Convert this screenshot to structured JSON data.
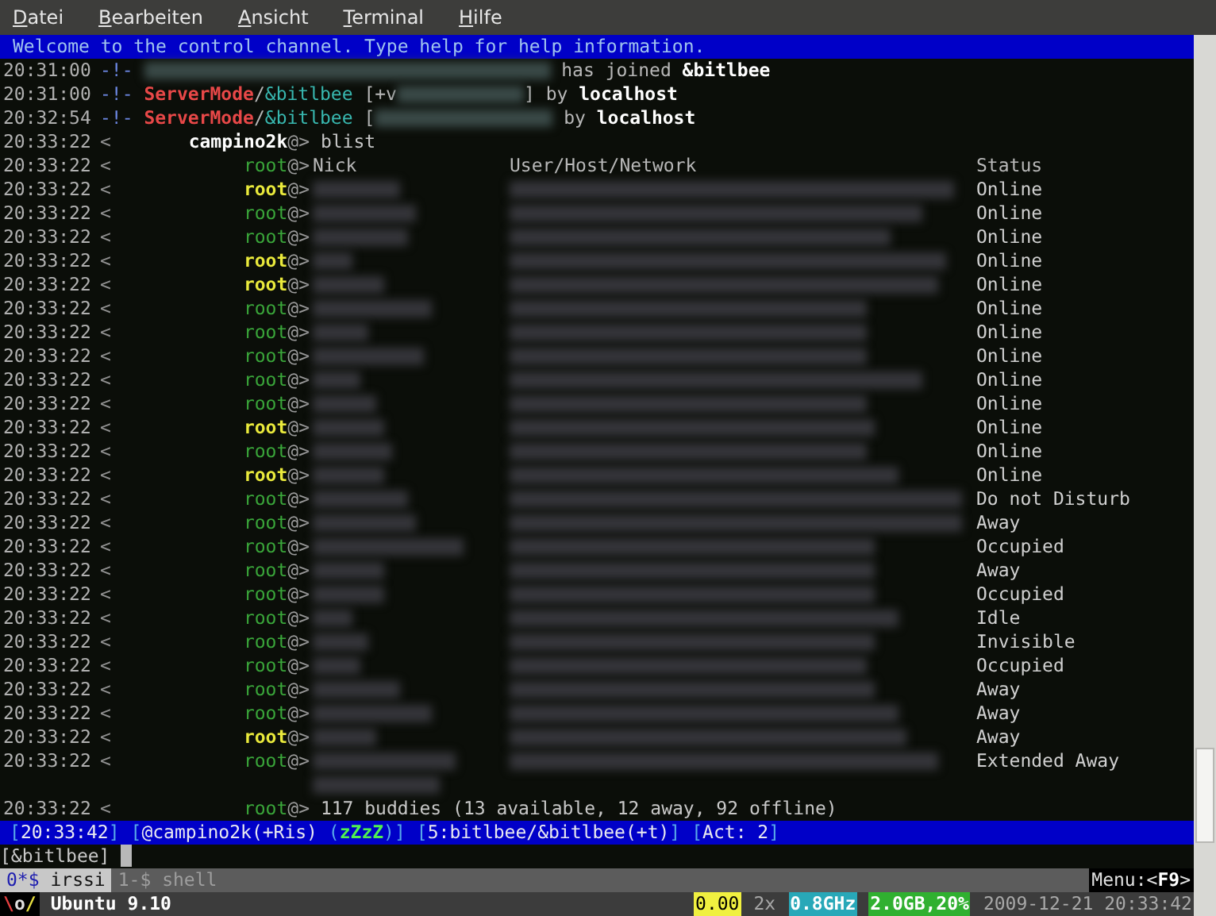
{
  "menu": [
    "Datei",
    "Bearbeiten",
    "Ansicht",
    "Terminal",
    "Hilfe"
  ],
  "topic": "Welcome to the control channel. Type help for help information.",
  "lines": [
    {
      "kind": "event",
      "time": "20:31:00",
      "segments": [
        {
          "kind": "text",
          "runs": [
            {
              "text": "-!- ",
              "kind": "marker"
            }
          ]
        },
        {
          "kind": "redacted"
        },
        {
          "kind": "text",
          "runs": [
            {
              "text": " has joined ",
              "kind": "plain"
            },
            {
              "text": "&bitlbee",
              "kind": "bold"
            }
          ]
        }
      ]
    },
    {
      "kind": "event",
      "time": "20:31:00",
      "segments": [
        {
          "kind": "text",
          "runs": [
            {
              "text": "-!- ",
              "kind": "marker"
            },
            {
              "text": "ServerMode",
              "kind": "mode"
            },
            {
              "text": "/",
              "kind": "plain"
            },
            {
              "text": "&bitlbee",
              "kind": "channel"
            },
            {
              "text": " [+v",
              "kind": "plain"
            }
          ]
        },
        {
          "kind": "redacted"
        },
        {
          "kind": "text",
          "runs": [
            {
              "text": "] by ",
              "kind": "plain"
            },
            {
              "text": "localhost",
              "kind": "bold"
            }
          ]
        }
      ]
    },
    {
      "kind": "event",
      "time": "20:32:54",
      "segments": [
        {
          "kind": "text",
          "runs": [
            {
              "text": "-!- ",
              "kind": "marker"
            },
            {
              "text": "ServerMode",
              "kind": "mode"
            },
            {
              "text": "/",
              "kind": "plain"
            },
            {
              "text": "&bitlbee",
              "kind": "channel"
            },
            {
              "text": " [",
              "kind": "plain"
            }
          ]
        },
        {
          "kind": "redacted"
        },
        {
          "kind": "text",
          "runs": [
            {
              "text": " by ",
              "kind": "plain"
            },
            {
              "text": "localhost",
              "kind": "bold"
            }
          ]
        }
      ]
    },
    {
      "kind": "message",
      "time": "20:33:22",
      "open": "<",
      "nick": "campino2k",
      "suffix": "@>",
      "own": true,
      "text": "blist"
    },
    {
      "kind": "header",
      "time": "20:33:22",
      "open": "<",
      "nick": "root",
      "suffix": "@>",
      "highlighted": false,
      "columns": [
        "Nick",
        "User/Host/Network",
        "Status"
      ]
    },
    {
      "kind": "buddy",
      "time": "20:33:22",
      "open": "<",
      "nick": "root",
      "suffix": "@>",
      "highlighted": true,
      "status": "Online"
    },
    {
      "kind": "buddy",
      "time": "20:33:22",
      "open": "<",
      "nick": "root",
      "suffix": "@>",
      "highlighted": false,
      "status": "Online"
    },
    {
      "kind": "buddy",
      "time": "20:33:22",
      "open": "<",
      "nick": "root",
      "suffix": "@>",
      "highlighted": false,
      "status": "Online"
    },
    {
      "kind": "buddy",
      "time": "20:33:22",
      "open": "<",
      "nick": "root",
      "suffix": "@>",
      "highlighted": true,
      "status": "Online"
    },
    {
      "kind": "buddy",
      "time": "20:33:22",
      "open": "<",
      "nick": "root",
      "suffix": "@>",
      "highlighted": true,
      "status": "Online"
    },
    {
      "kind": "buddy",
      "time": "20:33:22",
      "open": "<",
      "nick": "root",
      "suffix": "@>",
      "highlighted": false,
      "status": "Online"
    },
    {
      "kind": "buddy",
      "time": "20:33:22",
      "open": "<",
      "nick": "root",
      "suffix": "@>",
      "highlighted": false,
      "status": "Online"
    },
    {
      "kind": "buddy",
      "time": "20:33:22",
      "open": "<",
      "nick": "root",
      "suffix": "@>",
      "highlighted": false,
      "status": "Online"
    },
    {
      "kind": "buddy",
      "time": "20:33:22",
      "open": "<",
      "nick": "root",
      "suffix": "@>",
      "highlighted": false,
      "status": "Online"
    },
    {
      "kind": "buddy",
      "time": "20:33:22",
      "open": "<",
      "nick": "root",
      "suffix": "@>",
      "highlighted": false,
      "status": "Online"
    },
    {
      "kind": "buddy",
      "time": "20:33:22",
      "open": "<",
      "nick": "root",
      "suffix": "@>",
      "highlighted": true,
      "status": "Online"
    },
    {
      "kind": "buddy",
      "time": "20:33:22",
      "open": "<",
      "nick": "root",
      "suffix": "@>",
      "highlighted": false,
      "status": "Online"
    },
    {
      "kind": "buddy",
      "time": "20:33:22",
      "open": "<",
      "nick": "root",
      "suffix": "@>",
      "highlighted": true,
      "status": "Online"
    },
    {
      "kind": "buddy",
      "time": "20:33:22",
      "open": "<",
      "nick": "root",
      "suffix": "@>",
      "highlighted": false,
      "status": "Do not Disturb"
    },
    {
      "kind": "buddy",
      "time": "20:33:22",
      "open": "<",
      "nick": "root",
      "suffix": "@>",
      "highlighted": false,
      "status": "Away"
    },
    {
      "kind": "buddy",
      "time": "20:33:22",
      "open": "<",
      "nick": "root",
      "suffix": "@>",
      "highlighted": false,
      "status": "Occupied"
    },
    {
      "kind": "buddy",
      "time": "20:33:22",
      "open": "<",
      "nick": "root",
      "suffix": "@>",
      "highlighted": false,
      "status": "Away"
    },
    {
      "kind": "buddy",
      "time": "20:33:22",
      "open": "<",
      "nick": "root",
      "suffix": "@>",
      "highlighted": false,
      "status": "Occupied"
    },
    {
      "kind": "buddy",
      "time": "20:33:22",
      "open": "<",
      "nick": "root",
      "suffix": "@>",
      "highlighted": false,
      "status": "Idle"
    },
    {
      "kind": "buddy",
      "time": "20:33:22",
      "open": "<",
      "nick": "root",
      "suffix": "@>",
      "highlighted": false,
      "status": "Invisible"
    },
    {
      "kind": "buddy",
      "time": "20:33:22",
      "open": "<",
      "nick": "root",
      "suffix": "@>",
      "highlighted": false,
      "status": "Occupied"
    },
    {
      "kind": "buddy",
      "time": "20:33:22",
      "open": "<",
      "nick": "root",
      "suffix": "@>",
      "highlighted": false,
      "status": "Away"
    },
    {
      "kind": "buddy",
      "time": "20:33:22",
      "open": "<",
      "nick": "root",
      "suffix": "@>",
      "highlighted": false,
      "status": "Away"
    },
    {
      "kind": "buddy",
      "time": "20:33:22",
      "open": "<",
      "nick": "root",
      "suffix": "@>",
      "highlighted": true,
      "status": "Away"
    },
    {
      "kind": "buddy",
      "time": "20:33:22",
      "open": "<",
      "nick": "root",
      "suffix": "@>",
      "highlighted": false,
      "status": "Extended Away"
    },
    {
      "kind": "continuation"
    },
    {
      "kind": "message",
      "time": "20:33:22",
      "open": "<",
      "nick": "root",
      "suffix": "@>",
      "own": false,
      "highlighted": false,
      "text": "117 buddies (13 available, 12 away, 92 offline)"
    }
  ],
  "status_bar": [
    {
      "runs": [
        {
          "text": "[",
          "kind": "bracket"
        },
        {
          "text": "20:33:42",
          "kind": "text"
        },
        {
          "text": "]",
          "kind": "bracket"
        }
      ]
    },
    {
      "runs": [
        {
          "text": "[",
          "kind": "bracket"
        },
        {
          "text": "@campino2k(+Ris) ",
          "kind": "text"
        },
        {
          "text": "(",
          "kind": "bracket"
        },
        {
          "text": "zZzZ",
          "kind": "away"
        },
        {
          "text": ")]",
          "kind": "bracket"
        }
      ]
    },
    {
      "runs": [
        {
          "text": "[",
          "kind": "bracket"
        },
        {
          "text": "5:bitlbee/&bitlbee(+t)",
          "kind": "text"
        },
        {
          "text": "]",
          "kind": "bracket"
        }
      ]
    },
    {
      "runs": [
        {
          "text": "[",
          "kind": "bracket"
        },
        {
          "text": "Act: 2",
          "kind": "text"
        },
        {
          "text": "]",
          "kind": "bracket"
        }
      ]
    }
  ],
  "input": {
    "prompt": "[&bitlbee]"
  },
  "screen_tabs": [
    {
      "number": "0*$",
      "name": "irssi",
      "selected": true
    },
    {
      "number": "1-$",
      "name": "shell",
      "selected": false
    }
  ],
  "menu_hint": [
    {
      "text": "Menu:<",
      "kind": "plain"
    },
    {
      "text": "F9",
      "kind": "key"
    },
    {
      "text": ">",
      "kind": "plain"
    }
  ],
  "bottom_bar": {
    "logo": [
      {
        "text": "\\",
        "kind": "arm"
      },
      {
        "text": "o",
        "kind": "head"
      },
      {
        "text": "/",
        "kind": "hand"
      }
    ],
    "host": "Ubuntu 9.10",
    "items": [
      {
        "text": "0.00",
        "kind": "load"
      },
      {
        "text": "2x",
        "kind": "dim"
      },
      {
        "text": "0.8GHz",
        "kind": "cpu"
      },
      {
        "text": "2.0GB,20%",
        "kind": "mem"
      },
      {
        "text": "2009-12-21 20:33:42",
        "kind": "dim"
      }
    ]
  }
}
